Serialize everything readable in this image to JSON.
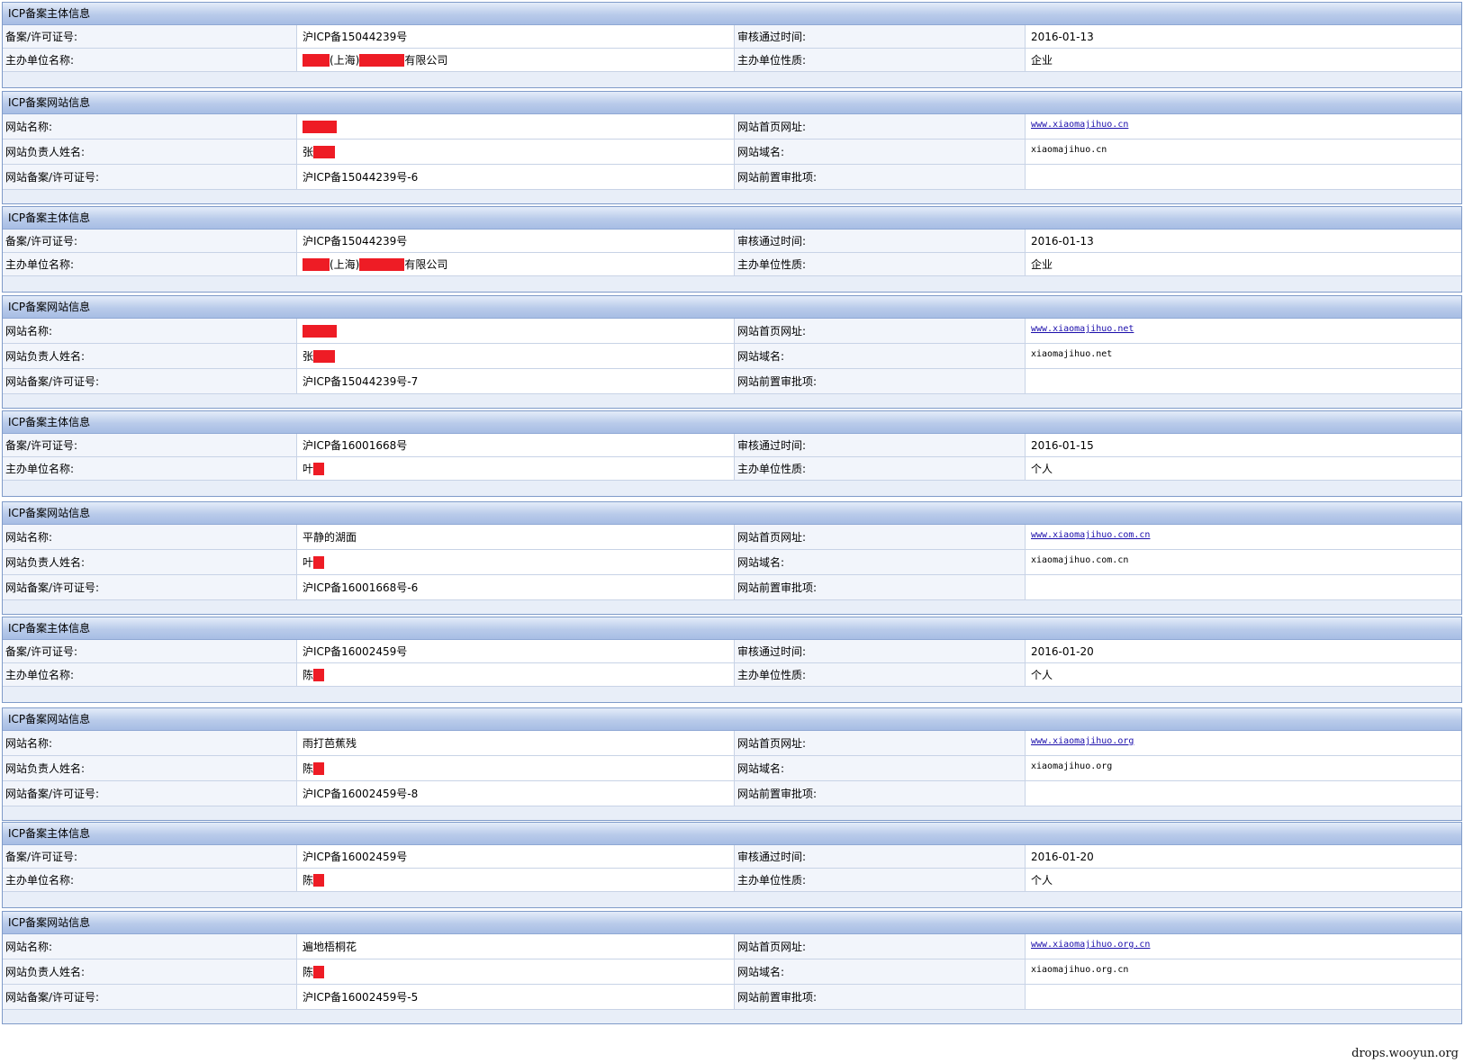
{
  "colors": {
    "redaction": "#ee1c25",
    "header_start": "#e4ecf9",
    "header_end": "#a7bde4",
    "link": "#1a0dab"
  },
  "blocks": [
    {
      "title": "ICP备案主体信息",
      "rows": [
        {
          "label1": "备案/许可证号:",
          "value1": [
            "沪ICP备15044239号"
          ],
          "label2": "审核通过时间:",
          "value2": "2016-01-13"
        },
        {
          "label1": "主办单位名称:",
          "value1": [
            "",
            "(上海)",
            "",
            "有限公司"
          ],
          "label2": "主办单位性质:",
          "value2": "企业"
        }
      ]
    },
    {
      "title": "ICP备案网站信息",
      "rows": [
        {
          "label1": "网站名称:",
          "value1": [
            ""
          ],
          "label2": "网站首页网址:",
          "value2": "www.xiaomajihuo.cn",
          "value2_type": "link"
        },
        {
          "label1": "网站负责人姓名:",
          "value1": [
            "张",
            ""
          ],
          "label2": "网站域名:",
          "value2": "xiaomajihuo.cn",
          "value2_type": "mono"
        },
        {
          "label1": "网站备案/许可证号:",
          "value1": [
            "沪ICP备15044239号-6"
          ],
          "label2": "网站前置审批项:",
          "value2": ""
        }
      ]
    },
    {
      "title": "ICP备案主体信息",
      "rows": [
        {
          "label1": "备案/许可证号:",
          "value1": [
            "沪ICP备15044239号"
          ],
          "label2": "审核通过时间:",
          "value2": "2016-01-13"
        },
        {
          "label1": "主办单位名称:",
          "value1": [
            "",
            "(上海)",
            "",
            "有限公司"
          ],
          "label2": "主办单位性质:",
          "value2": "企业"
        }
      ]
    },
    {
      "title": "ICP备案网站信息",
      "rows": [
        {
          "label1": "网站名称:",
          "value1": [
            ""
          ],
          "label2": "网站首页网址:",
          "value2": "www.xiaomajihuo.net",
          "value2_type": "link"
        },
        {
          "label1": "网站负责人姓名:",
          "value1": [
            "张",
            ""
          ],
          "label2": "网站域名:",
          "value2": "xiaomajihuo.net",
          "value2_type": "mono"
        },
        {
          "label1": "网站备案/许可证号:",
          "value1": [
            "沪ICP备15044239号-7"
          ],
          "label2": "网站前置审批项:",
          "value2": ""
        }
      ]
    },
    {
      "title": "ICP备案主体信息",
      "rows": [
        {
          "label1": "备案/许可证号:",
          "value1": [
            "沪ICP备16001668号"
          ],
          "label2": "审核通过时间:",
          "value2": "2016-01-15"
        },
        {
          "label1": "主办单位名称:",
          "value1": [
            "叶",
            ""
          ],
          "label2": "主办单位性质:",
          "value2": "个人"
        }
      ]
    },
    {
      "title": "ICP备案网站信息",
      "rows": [
        {
          "label1": "网站名称:",
          "value1": [
            "平静的湖面"
          ],
          "label2": "网站首页网址:",
          "value2": "www.xiaomajihuo.com.cn",
          "value2_type": "link"
        },
        {
          "label1": "网站负责人姓名:",
          "value1": [
            "叶",
            ""
          ],
          "label2": "网站域名:",
          "value2": "xiaomajihuo.com.cn",
          "value2_type": "mono"
        },
        {
          "label1": "网站备案/许可证号:",
          "value1": [
            "沪ICP备16001668号-6"
          ],
          "label2": "网站前置审批项:",
          "value2": ""
        }
      ]
    },
    {
      "title": "ICP备案主体信息",
      "rows": [
        {
          "label1": "备案/许可证号:",
          "value1": [
            "沪ICP备16002459号"
          ],
          "label2": "审核通过时间:",
          "value2": "2016-01-20"
        },
        {
          "label1": "主办单位名称:",
          "value1": [
            "陈",
            ""
          ],
          "label2": "主办单位性质:",
          "value2": "个人"
        }
      ]
    },
    {
      "title": "ICP备案网站信息",
      "rows": [
        {
          "label1": "网站名称:",
          "value1": [
            "雨打芭蕉残"
          ],
          "label2": "网站首页网址:",
          "value2": "www.xiaomajihuo.org",
          "value2_type": "link"
        },
        {
          "label1": "网站负责人姓名:",
          "value1": [
            "陈",
            ""
          ],
          "label2": "网站域名:",
          "value2": "xiaomajihuo.org",
          "value2_type": "mono"
        },
        {
          "label1": "网站备案/许可证号:",
          "value1": [
            "沪ICP备16002459号-8"
          ],
          "label2": "网站前置审批项:",
          "value2": ""
        }
      ]
    },
    {
      "title": "ICP备案主体信息",
      "rows": [
        {
          "label1": "备案/许可证号:",
          "value1": [
            "沪ICP备16002459号"
          ],
          "label2": "审核通过时间:",
          "value2": "2016-01-20"
        },
        {
          "label1": "主办单位名称:",
          "value1": [
            "陈",
            ""
          ],
          "label2": "主办单位性质:",
          "value2": "个人"
        }
      ]
    },
    {
      "title": "ICP备案网站信息",
      "rows": [
        {
          "label1": "网站名称:",
          "value1": [
            "遍地梧桐花"
          ],
          "label2": "网站首页网址:",
          "value2": "www.xiaomajihuo.org.cn",
          "value2_type": "link"
        },
        {
          "label1": "网站负责人姓名:",
          "value1": [
            "陈",
            ""
          ],
          "label2": "网站域名:",
          "value2": "xiaomajihuo.org.cn",
          "value2_type": "mono"
        },
        {
          "label1": "网站备案/许可证号:",
          "value1": [
            "沪ICP备16002459号-5"
          ],
          "label2": "网站前置审批项:",
          "value2": ""
        }
      ]
    }
  ],
  "watermark": "drops.wooyun.org"
}
